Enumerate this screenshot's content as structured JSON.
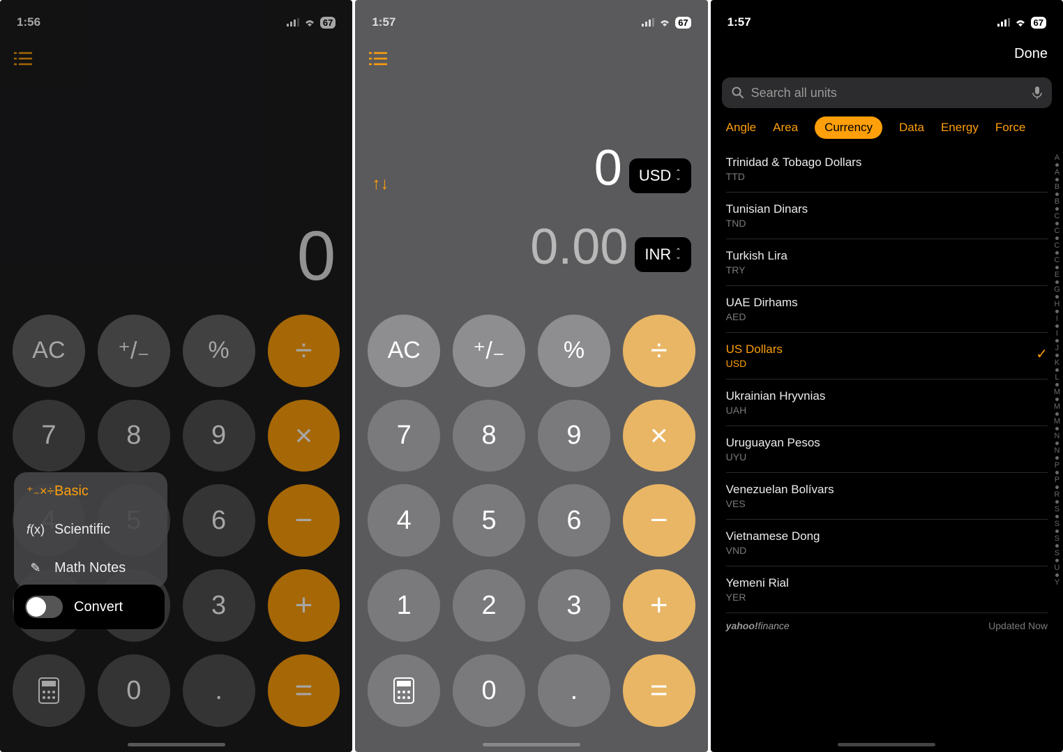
{
  "status": {
    "time1": "1:56",
    "time2": "1:57",
    "time3": "1:57",
    "battery": "67"
  },
  "panel1": {
    "display": "0",
    "menu": {
      "basic": "Basic",
      "scientific": "Scientific",
      "notes": "Math Notes"
    },
    "convert_label": "Convert"
  },
  "panel2": {
    "value_from": "0",
    "value_to": "0.00",
    "unit_from": "USD",
    "unit_to": "INR"
  },
  "keys": {
    "ac": "AC",
    "sign": "⁺/₋",
    "pct": "%",
    "div": "÷",
    "k7": "7",
    "k8": "8",
    "k9": "9",
    "mul": "×",
    "k4": "4",
    "k5": "5",
    "k6": "6",
    "sub": "−",
    "k1": "1",
    "k2": "2",
    "k3": "3",
    "add": "+",
    "k0": "0",
    "dot": ".",
    "eq": "="
  },
  "panel3": {
    "done": "Done",
    "search_placeholder": "Search all units",
    "tabs": {
      "angle": "Angle",
      "area": "Area",
      "currency": "Currency",
      "data": "Data",
      "energy": "Energy",
      "force": "Force"
    },
    "units": [
      {
        "name": "Trinidad & Tobago Dollars",
        "code": "TTD"
      },
      {
        "name": "Tunisian Dinars",
        "code": "TND"
      },
      {
        "name": "Turkish Lira",
        "code": "TRY"
      },
      {
        "name": "UAE Dirhams",
        "code": "AED"
      },
      {
        "name": "US Dollars",
        "code": "USD",
        "selected": true
      },
      {
        "name": "Ukrainian Hryvnias",
        "code": "UAH"
      },
      {
        "name": "Uruguayan Pesos",
        "code": "UYU"
      },
      {
        "name": "Venezuelan Bolívars",
        "code": "VES"
      },
      {
        "name": "Vietnamese Dong",
        "code": "VND"
      },
      {
        "name": "Yemeni Rial",
        "code": "YER"
      }
    ],
    "index_letters": [
      "A",
      "A",
      "B",
      "B",
      "C",
      "C",
      "C",
      "C",
      "E",
      "G",
      "H",
      "I",
      "I",
      "J",
      "K",
      "L",
      "M",
      "M",
      "M",
      "N",
      "N",
      "P",
      "P",
      "R",
      "S",
      "S",
      "S",
      "S",
      "U",
      "Y"
    ],
    "footer_source": "yahoo!finance",
    "footer_updated": "Updated Now"
  }
}
